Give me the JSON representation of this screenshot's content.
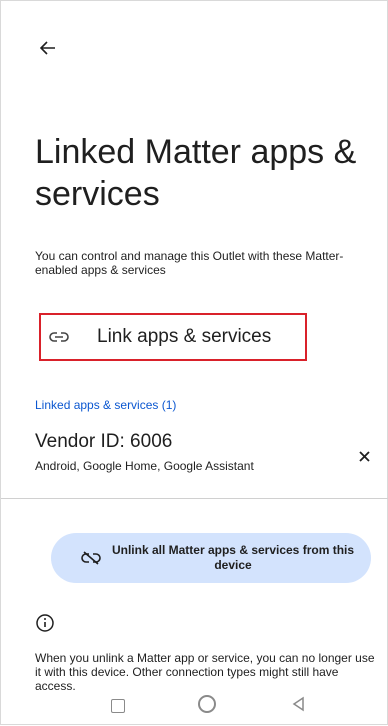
{
  "header": {
    "back_icon": "arrow-left-icon",
    "title": "Linked Matter apps & services"
  },
  "description": "You can control and manage this Outlet with these Matter-enabled apps & services",
  "link_button": {
    "icon": "link-icon",
    "label": "Link apps & services",
    "highlight_color": "#d9212a"
  },
  "linked_section": {
    "header": "Linked apps & services (1)",
    "header_color": "#0b57d0",
    "items": [
      {
        "title": "Vendor ID: 6006",
        "subtitle": "Android, Google Home, Google Assistant",
        "close_icon": "close-icon"
      }
    ]
  },
  "unlink_button": {
    "icon": "link-off-icon",
    "label": "Unlink all Matter apps & services from this device",
    "background": "#d3e3fd"
  },
  "info": {
    "icon": "info-icon",
    "text": "When you unlink a Matter app or service, you can no longer use it with this device. Other connection types might still have access."
  },
  "nav_bar": {
    "recents_icon": "square-recents-icon",
    "home_icon": "circle-home-icon",
    "back_icon": "triangle-back-icon"
  }
}
